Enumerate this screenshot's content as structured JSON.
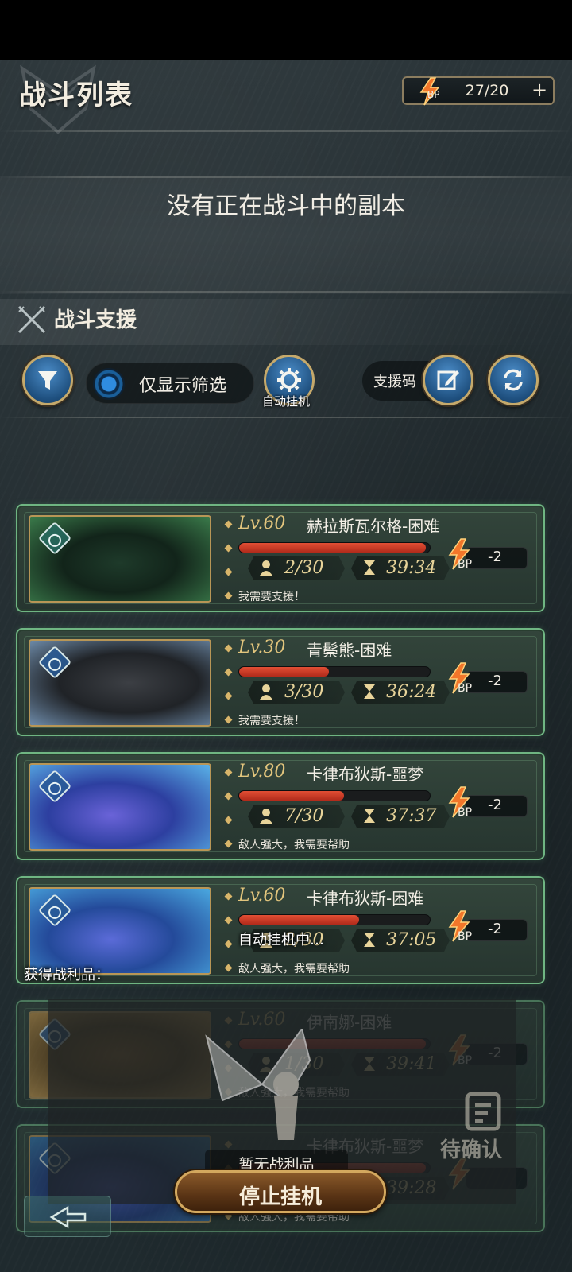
{
  "header": {
    "title": "战斗列表",
    "bp_label": "BP",
    "bp_value": "27/20",
    "plus": "+"
  },
  "status": {
    "no_battle": "没有正在战斗中的副本"
  },
  "support": {
    "title": "战斗支援",
    "filter_toggle_label": "仅显示筛选",
    "auto_label": "自动挂机",
    "code_label": "支援码"
  },
  "cards": [
    {
      "level": "Lv.60",
      "name": "赫拉斯瓦尔格-困难",
      "hp_percent": 98,
      "players": "2/30",
      "time": "39:34",
      "message": "我需要支援！",
      "cost": "-2",
      "bp_label": "BP"
    },
    {
      "level": "Lv.30",
      "name": "青鬃熊-困难",
      "hp_percent": 47,
      "players": "3/30",
      "time": "36:24",
      "message": "我需要支援！",
      "cost": "-2",
      "bp_label": "BP"
    },
    {
      "level": "Lv.80",
      "name": "卡律布狄斯-噩梦",
      "hp_percent": 55,
      "players": "7/30",
      "time": "37:37",
      "message": "敌人强大，我需要帮助",
      "cost": "-2",
      "bp_label": "BP"
    },
    {
      "level": "Lv.60",
      "name": "卡律布狄斯-困难",
      "hp_percent": 63,
      "players": "2/30",
      "time": "37:05",
      "message": "敌人强大，我需要帮助",
      "cost": "-2",
      "bp_label": "BP"
    },
    {
      "level": "Lv.60",
      "name": "伊南娜-困难",
      "hp_percent": 98,
      "players": "1/30",
      "time": "39:41",
      "message": "敌人强大，我需要帮助",
      "cost": "-2",
      "bp_label": "BP"
    },
    {
      "level": "",
      "name": "卡律布狄斯-噩梦",
      "hp_percent": 98,
      "players": "",
      "time": "39:28",
      "message": "敌人强大，我需要帮助",
      "cost": "",
      "bp_label": ""
    }
  ],
  "overlay": {
    "auto_running": "自动挂机中…",
    "loot_label": "获得战利品：",
    "no_loot": "暂无战利品",
    "pending": "待确认",
    "stop": "停止挂机"
  },
  "colors": {
    "card_border": "#6fb582",
    "gold": "#e2c57d",
    "hp_fill": "#e24e34",
    "button_blue": "#1e4f7e"
  }
}
